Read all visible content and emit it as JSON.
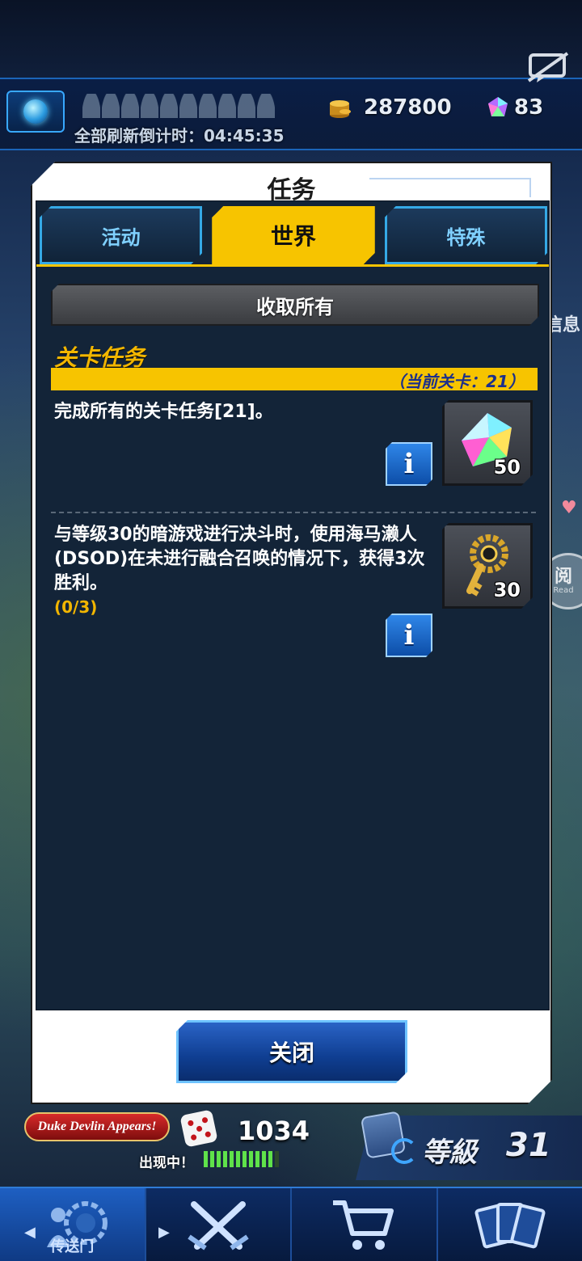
{
  "hud": {
    "refresh_countdown": "全部刷新倒计时：04:45:35",
    "gold": "287800",
    "gems": "83"
  },
  "background": {
    "side_label": "信息",
    "read_label": "阅",
    "read_sub": "Read",
    "event_banner": "Duke Devlin Appears!",
    "event_status": "出现中！",
    "event_progress_fraction": 0.9,
    "dice_count": "1034",
    "level_label": "等級",
    "level_value": "31"
  },
  "dialog": {
    "title": "任务",
    "tabs": [
      {
        "label": "活动",
        "active": false
      },
      {
        "label": "世界",
        "active": true
      },
      {
        "label": "特殊",
        "active": false
      }
    ],
    "claim_all_label": "收取所有",
    "section": {
      "title": "关卡任务",
      "current_stage": "（当前关卡：21）"
    },
    "missions": [
      {
        "text": "完成所有的关卡任务[21]。",
        "progress": "",
        "reward_icon": "gem-icon",
        "reward_count": "50"
      },
      {
        "text": "与等级30的暗游戏进行决斗时，使用海马濑人(DSOD)在未进行融合召唤的情况下，获得3次胜利。",
        "progress": "(0/3)",
        "reward_icon": "key-icon",
        "reward_count": "30"
      }
    ],
    "info_label": "i",
    "close_label": "关闭"
  },
  "nav": {
    "items": [
      {
        "label": "传送门",
        "icon": "portal-icon"
      },
      {
        "label": "",
        "icon": "duel-swords-icon"
      },
      {
        "label": "",
        "icon": "shop-cart-icon"
      },
      {
        "label": "",
        "icon": "deck-cards-icon"
      }
    ]
  },
  "colors": {
    "accent_yellow": "#f7c400",
    "panel_bg": "#132438",
    "tab_border": "#35a9e6",
    "button_blue": "#0f3e91"
  }
}
